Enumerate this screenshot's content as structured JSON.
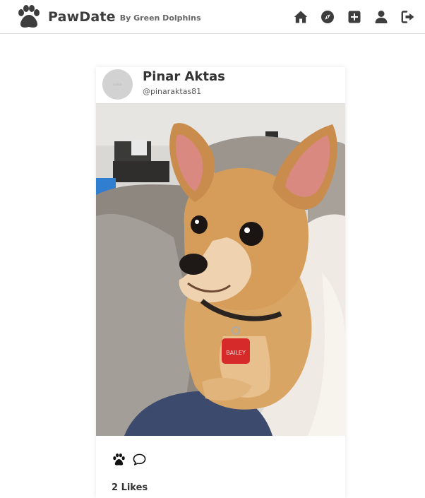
{
  "header": {
    "brand_name": "PawDate",
    "brand_sub": "By Green Dolphins",
    "brand_icon": "paw-logo-icon",
    "nav_icons": [
      "home-icon",
      "compass-icon",
      "plus-square-icon",
      "user-icon",
      "logout-icon"
    ]
  },
  "post": {
    "avatar_text": "avatar",
    "user_name": "Pinar Aktas",
    "user_handle": "@pinaraktas81",
    "photo_subject": "dog-photo",
    "tag_text": "BAILEY",
    "action_icons": [
      "paw-like-icon",
      "comment-bubble-icon"
    ],
    "likes": "2 Likes"
  },
  "colors": {
    "icon": "#3d3d3d",
    "divider": "#dcdcdc",
    "avatar_bg": "#d2d2d2",
    "text": "#333333"
  }
}
